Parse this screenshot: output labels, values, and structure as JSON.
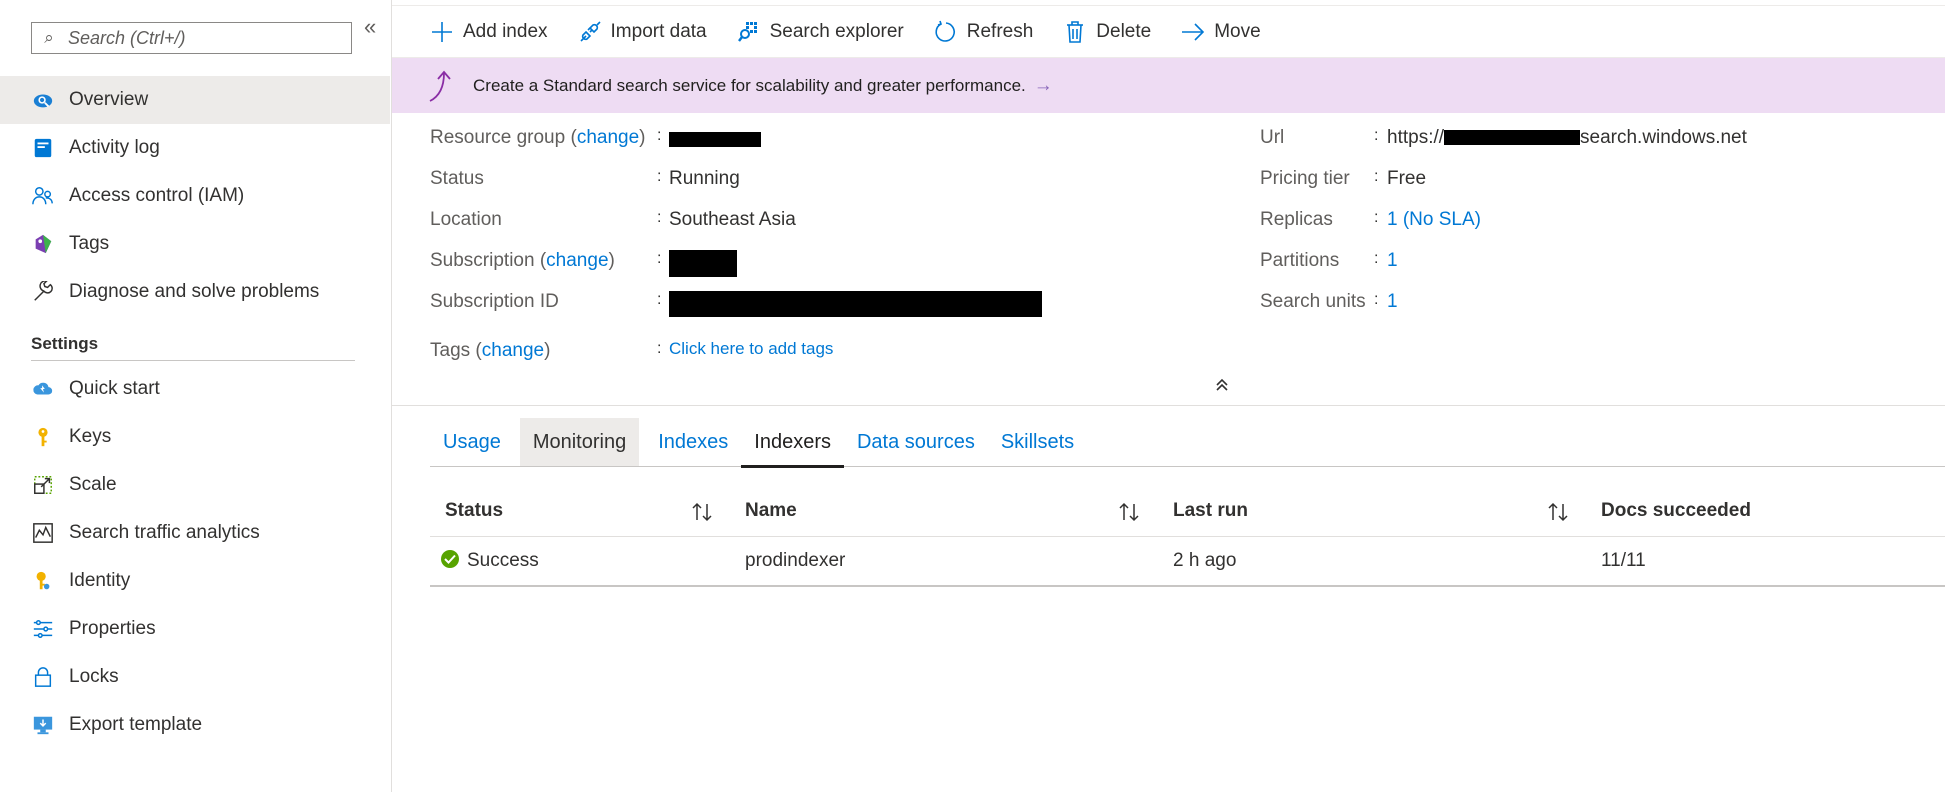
{
  "sidebar": {
    "search_placeholder": "Search (Ctrl+/)",
    "collapse_glyph": "«",
    "items": [
      {
        "label": "Overview",
        "icon": "search-service-icon",
        "active": true
      },
      {
        "label": "Activity log",
        "icon": "activity-log-icon"
      },
      {
        "label": "Access control (IAM)",
        "icon": "people-icon"
      },
      {
        "label": "Tags",
        "icon": "tag-icon"
      },
      {
        "label": "Diagnose and solve problems",
        "icon": "wrench-icon"
      }
    ],
    "settings_title": "Settings",
    "settings_items": [
      {
        "label": "Quick start",
        "icon": "cloud-icon"
      },
      {
        "label": "Keys",
        "icon": "key-icon"
      },
      {
        "label": "Scale",
        "icon": "scale-icon"
      },
      {
        "label": "Search traffic analytics",
        "icon": "analytics-icon"
      },
      {
        "label": "Identity",
        "icon": "identity-key-icon"
      },
      {
        "label": "Properties",
        "icon": "properties-icon"
      },
      {
        "label": "Locks",
        "icon": "lock-icon"
      },
      {
        "label": "Export template",
        "icon": "export-template-icon"
      }
    ]
  },
  "toolbar": {
    "add_index": "Add index",
    "import_data": "Import data",
    "search_explorer": "Search explorer",
    "refresh": "Refresh",
    "delete": "Delete",
    "move": "Move"
  },
  "banner": {
    "text": "Create a Standard search service for scalability and greater performance.",
    "arrow": "→"
  },
  "essentials": {
    "resource_group_label": "Resource group",
    "subscription_label": "Subscription",
    "tags_label": "Tags",
    "change_link": "change",
    "status_label": "Status",
    "status_value": "Running",
    "location_label": "Location",
    "location_value": "Southeast Asia",
    "subscription_id_label": "Subscription ID",
    "tags_value": "Click here to add tags",
    "url_label": "Url",
    "url_prefix": "https://",
    "url_suffix": "search.windows.net",
    "pricing_tier_label": "Pricing tier",
    "pricing_tier_value": "Free",
    "replicas_label": "Replicas",
    "replicas_value": "1 (No SLA)",
    "partitions_label": "Partitions",
    "partitions_value": "1",
    "search_units_label": "Search units",
    "search_units_value": "1",
    "colon": ":"
  },
  "tabs": [
    "Usage",
    "Monitoring",
    "Indexes",
    "Indexers",
    "Data sources",
    "Skillsets"
  ],
  "selected_tab": "Indexers",
  "indexers_table": {
    "columns": [
      "Status",
      "Name",
      "Last run",
      "Docs succeeded"
    ],
    "rows": [
      {
        "status": "Success",
        "name": "prodindexer",
        "last_run": "2 h ago",
        "docs_succeeded": "11/11"
      }
    ]
  },
  "colors": {
    "accent": "#0078d4",
    "banner_bg": "#eedcf3",
    "success": "#57a300"
  }
}
